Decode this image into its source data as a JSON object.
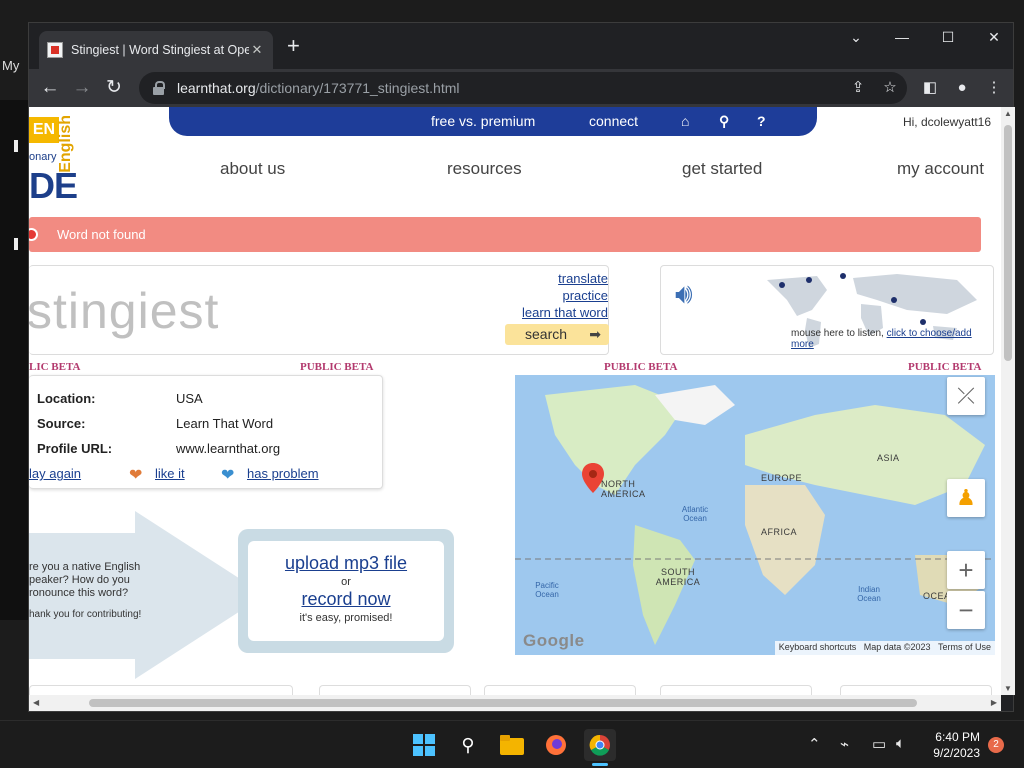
{
  "desktop": {
    "label": "My"
  },
  "browser": {
    "tab_title": "Stingiest | Word Stingiest at Oper",
    "tab_close": "✕",
    "new_tab": "+",
    "url_host": "learnthat.org",
    "url_path": "/dictionary/173771_stingiest.html"
  },
  "site": {
    "logo": {
      "top_left": "EN",
      "onary": "onary",
      "english": "English",
      "big": "DE"
    },
    "topnav": {
      "free_vs_premium": "free vs. premium",
      "connect": "connect",
      "help": "?"
    },
    "greeting": "Hi, dcolewyatt16",
    "mainnav": [
      "about us",
      "resources",
      "get started",
      "my account"
    ],
    "alert": "Word not found",
    "word": "stingiest",
    "word_links": [
      "translate",
      "practice",
      "learn that word"
    ],
    "search_label": "search",
    "listen_hint": "mouse here to listen, ",
    "listen_link": "click to choose/add more",
    "beta_labels": [
      "PUBLIC BETA",
      "PUBLIC BETA",
      "PUBLIC BETA",
      "PUBLIC BETA"
    ],
    "beta_first": "LIC BETA",
    "info": {
      "location_label": "Location:",
      "location_value": "USA",
      "source_label": "Source:",
      "source_value": "Learn That Word",
      "profile_label": "Profile URL:",
      "profile_value": "www.learnthat.org",
      "play_again": "lay again",
      "like_it": "like it",
      "has_problem": "has problem"
    },
    "native": {
      "question": "re you a native English peaker? How do you ronounce this word?",
      "thanks": "hank you for contributing!"
    },
    "upload": {
      "upload_mp3": "upload mp3 file",
      "or": "or",
      "record_now": "record now",
      "easy": "it's easy, promised!"
    },
    "map": {
      "labels": {
        "north_america": "NORTH AMERICA",
        "europe": "EUROPE",
        "asia": "ASIA",
        "africa": "AFRICA",
        "south_america": "SOUTH AMERICA",
        "atlantic": "Atlantic Ocean",
        "pacific": "Pacific Ocean",
        "indian": "Indian Ocean",
        "ocea": "OCEA"
      },
      "google": "Google",
      "keyboard": "Keyboard shortcuts",
      "map_data": "Map data ©2023",
      "terms": "Terms of Use",
      "zoom_in": "+",
      "zoom_out": "−"
    }
  },
  "taskbar": {
    "time": "6:40 PM",
    "date": "9/2/2023",
    "notifications": "2"
  },
  "colors": {
    "nav_blue": "#1e3d99",
    "alert_red": "#f28b82",
    "beta_magenta": "#b33a6e",
    "link_blue": "#1a3f8f",
    "search_yellow": "#fbe39a"
  }
}
